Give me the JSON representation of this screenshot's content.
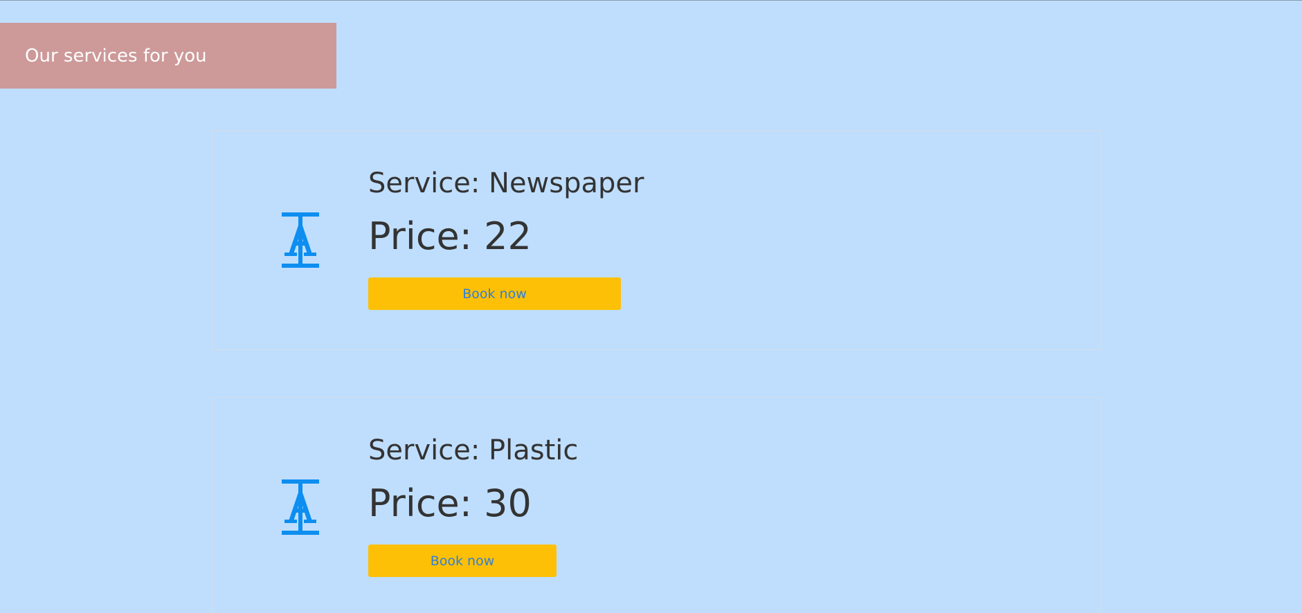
{
  "header": {
    "title": "Our services for you"
  },
  "services": [
    {
      "icon": "text-height-icon",
      "name": "Service: Newspaper",
      "price": "Price: 22",
      "button_label": "Book now"
    },
    {
      "icon": "text-height-icon",
      "name": "Service: Plastic",
      "price": "Price: 30",
      "button_label": "Book now"
    }
  ],
  "colors": {
    "background": "#bfdefd",
    "banner": "#cd9999",
    "button": "#fdc006",
    "button_text": "#2f7fd6",
    "icon": "#0d8ef0"
  }
}
